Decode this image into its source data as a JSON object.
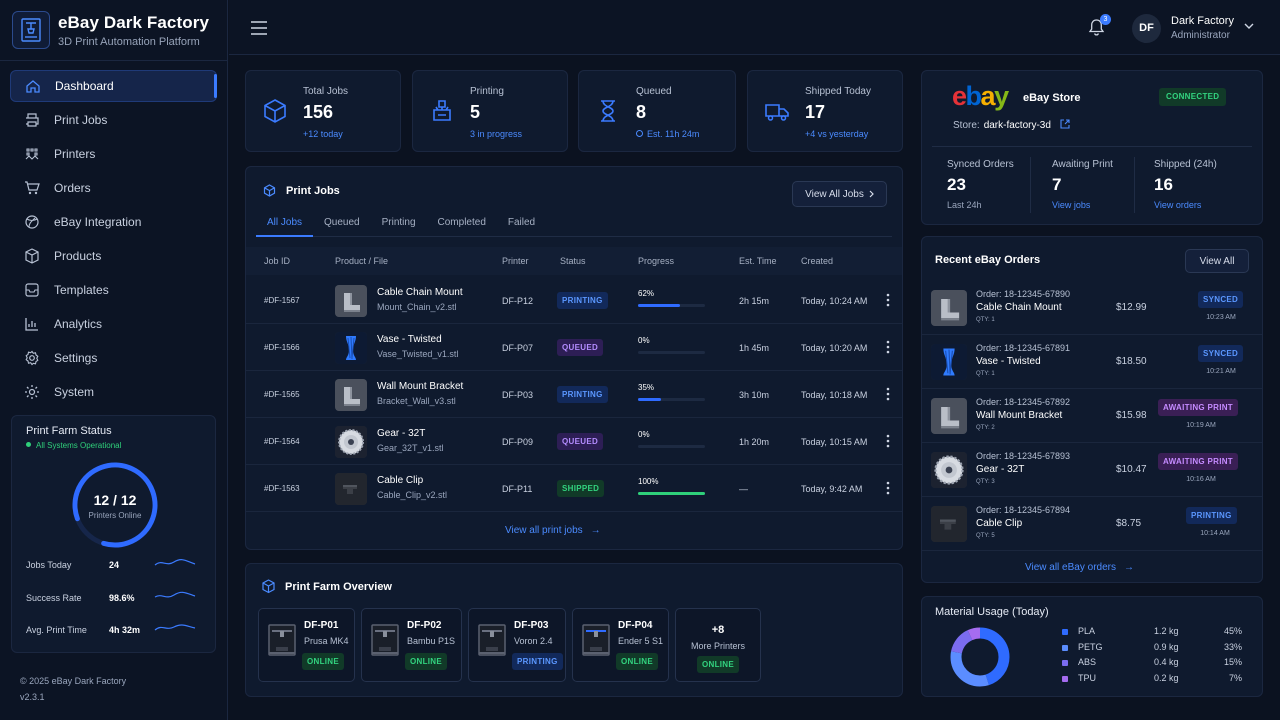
{
  "brand": {
    "title": "eBay Dark Factory",
    "subtitle": "3D Print Automation Platform"
  },
  "nav": [
    {
      "label": "Dashboard",
      "icon": "home-icon",
      "active": true
    },
    {
      "label": "Print Jobs",
      "icon": "printer-icon"
    },
    {
      "label": "Printers",
      "icon": "grid-icon"
    },
    {
      "label": "Orders",
      "icon": "cart-icon"
    },
    {
      "label": "eBay Integration",
      "icon": "sphere-icon"
    },
    {
      "label": "Products",
      "icon": "box-icon"
    },
    {
      "label": "Templates",
      "icon": "template-icon"
    },
    {
      "label": "Analytics",
      "icon": "bar-chart-icon"
    },
    {
      "label": "Settings",
      "icon": "gear-icon"
    },
    {
      "label": "System",
      "icon": "cog-icon"
    }
  ],
  "farm_status": {
    "title": "Print Farm Status",
    "status": "All Systems Operational",
    "printers_value": "12 / 12",
    "printers_label": "Printers Online",
    "online_fraction": 0.85,
    "stats": [
      {
        "label": "Jobs Today",
        "value": "24"
      },
      {
        "label": "Success Rate",
        "value": "98.6%"
      },
      {
        "label": "Avg. Print Time",
        "value": "4h 32m"
      }
    ]
  },
  "footer": {
    "copyright": "© 2025 eBay Dark Factory",
    "version": "v2.3.1"
  },
  "topbar": {
    "notifications": "3",
    "avatar": "DF",
    "user_name": "Dark Factory",
    "user_role": "Administrator"
  },
  "stats": [
    {
      "label": "Total Jobs",
      "value": "156",
      "sub": "+12 today",
      "icon": "cube-icon"
    },
    {
      "label": "Printing",
      "value": "5",
      "sub": "3 in progress",
      "icon": "printing-icon"
    },
    {
      "label": "Queued",
      "value": "8",
      "sub": "Est. 11h 24m",
      "icon": "hourglass-icon"
    },
    {
      "label": "Shipped Today",
      "value": "17",
      "sub": "+4 vs yesterday",
      "icon": "truck-icon"
    }
  ],
  "print_jobs": {
    "title": "Print Jobs",
    "view_all": "View All Jobs",
    "tabs": [
      "All Jobs",
      "Queued",
      "Printing",
      "Completed",
      "Failed"
    ],
    "columns": [
      "Job ID",
      "Product / File",
      "Printer",
      "Status",
      "Progress",
      "Est. Time",
      "Created"
    ],
    "rows": [
      {
        "id": "#DF-1567",
        "product": "Cable Chain Mount",
        "file": "Mount_Chain_v2.stl",
        "printer": "DF-P12",
        "status": "PRINTING",
        "progress": "62%",
        "progress_value": 62,
        "est": "2h 15m",
        "created": "Today, 10:24 AM",
        "thumb": "bracket"
      },
      {
        "id": "#DF-1566",
        "product": "Vase - Twisted",
        "file": "Vase_Twisted_v1.stl",
        "printer": "DF-P07",
        "status": "QUEUED",
        "progress": "0%",
        "progress_value": 0,
        "est": "1h 45m",
        "created": "Today, 10:20 AM",
        "thumb": "vase"
      },
      {
        "id": "#DF-1565",
        "product": "Wall Mount Bracket",
        "file": "Bracket_Wall_v3.stl",
        "printer": "DF-P03",
        "status": "PRINTING",
        "progress": "35%",
        "progress_value": 35,
        "est": "3h 10m",
        "created": "Today, 10:18 AM",
        "thumb": "bracket"
      },
      {
        "id": "#DF-1564",
        "product": "Gear - 32T",
        "file": "Gear_32T_v1.stl",
        "printer": "DF-P09",
        "status": "QUEUED",
        "progress": "0%",
        "progress_value": 0,
        "est": "1h 20m",
        "created": "Today, 10:15 AM",
        "thumb": "gear"
      },
      {
        "id": "#DF-1563",
        "product": "Cable Clip",
        "file": "Cable_Clip_v2.stl",
        "printer": "DF-P11",
        "status": "SHIPPED",
        "progress": "100%",
        "progress_value": 100,
        "est": "—",
        "created": "Today, 9:42 AM",
        "thumb": "clip"
      }
    ],
    "footer_link": "View all print jobs"
  },
  "farm_overview": {
    "title": "Print Farm Overview",
    "printers": [
      {
        "id": "DF-P01",
        "model": "Prusa MK4",
        "status": "ONLINE"
      },
      {
        "id": "DF-P02",
        "model": "Bambu P1S",
        "status": "ONLINE"
      },
      {
        "id": "DF-P03",
        "model": "Voron 2.4",
        "status": "PRINTING"
      },
      {
        "id": "DF-P04",
        "model": "Ender 5 S1",
        "status": "ONLINE"
      }
    ],
    "more": {
      "count": "+8",
      "label": "More Printers",
      "status": "ONLINE"
    }
  },
  "ebay_store": {
    "logo": [
      "e",
      "b",
      "a",
      "y"
    ],
    "logo_colors": [
      "#e53238",
      "#0064d2",
      "#f5af02",
      "#86b817"
    ],
    "title": "eBay Store",
    "status": "CONNECTED",
    "store_label": "Store:",
    "store_name": "dark-factory-3d",
    "metrics": [
      {
        "label": "Synced Orders",
        "value": "23",
        "sub": "Last 24h"
      },
      {
        "label": "Awaiting Print",
        "value": "7",
        "sub": "View jobs"
      },
      {
        "label": "Shipped (24h)",
        "value": "16",
        "sub": "View orders"
      }
    ]
  },
  "recent_orders": {
    "title": "Recent eBay Orders",
    "view_all": "View All",
    "rows": [
      {
        "order": "Order: 18-12345-67890",
        "product": "Cable Chain Mount",
        "qty": "QTY: 1",
        "price": "$12.99",
        "status": "SYNCED",
        "time": "10:23 AM",
        "thumb": "bracket"
      },
      {
        "order": "Order: 18-12345-67891",
        "product": "Vase - Twisted",
        "qty": "QTY: 1",
        "price": "$18.50",
        "status": "SYNCED",
        "time": "10:21 AM",
        "thumb": "vase"
      },
      {
        "order": "Order: 18-12345-67892",
        "product": "Wall Mount Bracket",
        "qty": "QTY: 2",
        "price": "$15.98",
        "status": "AWAITING PRINT",
        "time": "10:19 AM",
        "thumb": "bracket"
      },
      {
        "order": "Order: 18-12345-67893",
        "product": "Gear - 32T",
        "qty": "QTY: 3",
        "price": "$10.47",
        "status": "AWAITING PRINT",
        "time": "10:16 AM",
        "thumb": "gear"
      },
      {
        "order": "Order: 18-12345-67894",
        "product": "Cable Clip",
        "qty": "QTY: 5",
        "price": "$8.75",
        "status": "PRINTING",
        "time": "10:14 AM",
        "thumb": "clip"
      }
    ],
    "footer_link": "View all eBay orders"
  },
  "material_usage": {
    "title": "Material Usage (Today)",
    "items": [
      {
        "name": "PLA",
        "weight": "1.2 kg",
        "percent": "45%",
        "value": 45,
        "color": "#2f6bff"
      },
      {
        "name": "PETG",
        "weight": "0.9 kg",
        "percent": "33%",
        "value": 33,
        "color": "#5b8dff"
      },
      {
        "name": "ABS",
        "weight": "0.4 kg",
        "percent": "15%",
        "value": 15,
        "color": "#7b6cf0"
      },
      {
        "name": "TPU",
        "weight": "0.2 kg",
        "percent": "7%",
        "value": 7,
        "color": "#a56cf0"
      }
    ]
  }
}
